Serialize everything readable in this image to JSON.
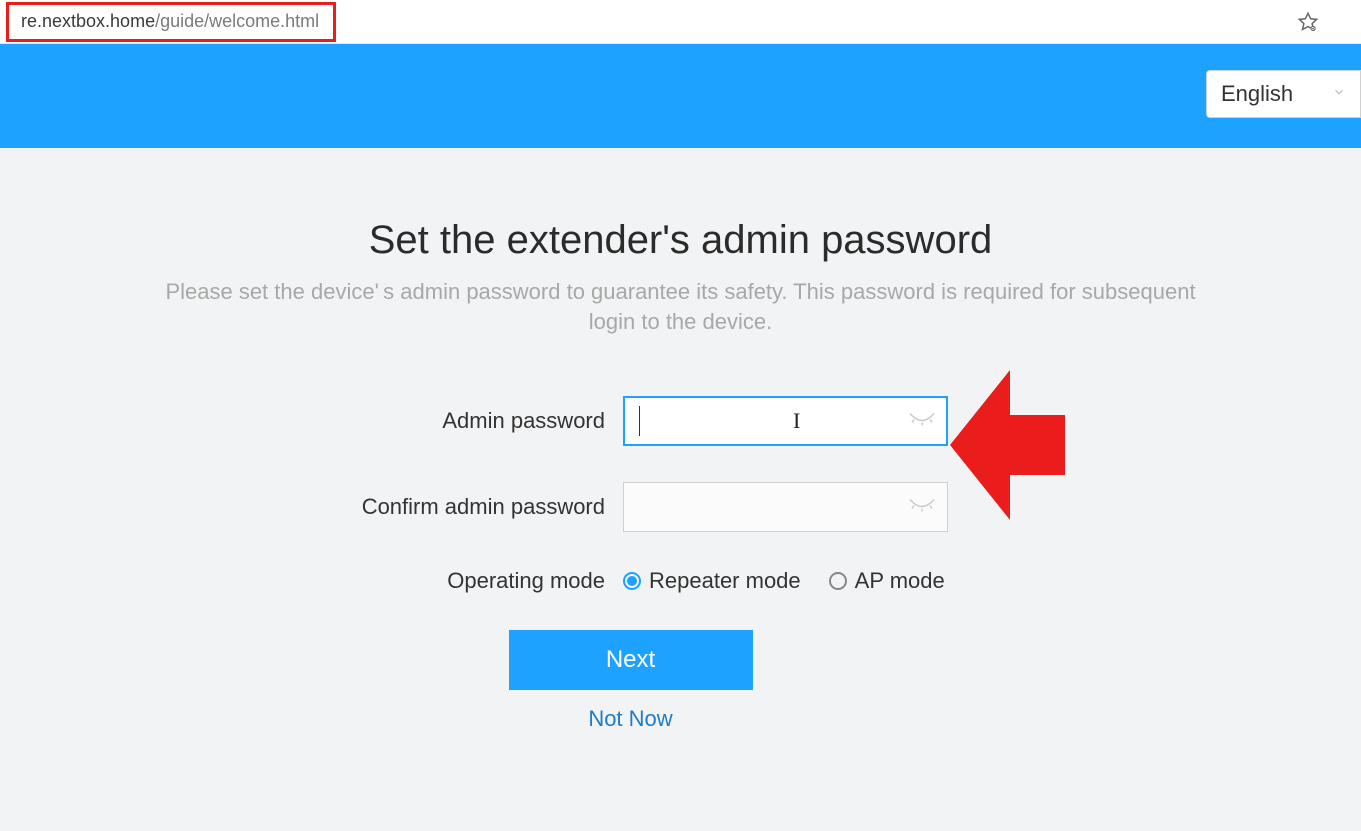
{
  "browser": {
    "url_domain": "re.nextbox.home",
    "url_path": "/guide/welcome.html"
  },
  "header": {
    "language_selected": "English"
  },
  "main": {
    "title": "Set the extender's admin password",
    "subtitle": "Please set the device' s admin password to guarantee its safety. This password is required for subsequent login to the device.",
    "labels": {
      "admin_password": "Admin password",
      "confirm_password": "Confirm admin password",
      "operating_mode": "Operating mode"
    },
    "fields": {
      "admin_password_value": "",
      "confirm_password_value": ""
    },
    "modes": {
      "repeater": "Repeater mode",
      "ap": "AP mode",
      "selected": "repeater"
    },
    "buttons": {
      "next": "Next",
      "not_now": "Not Now"
    }
  }
}
